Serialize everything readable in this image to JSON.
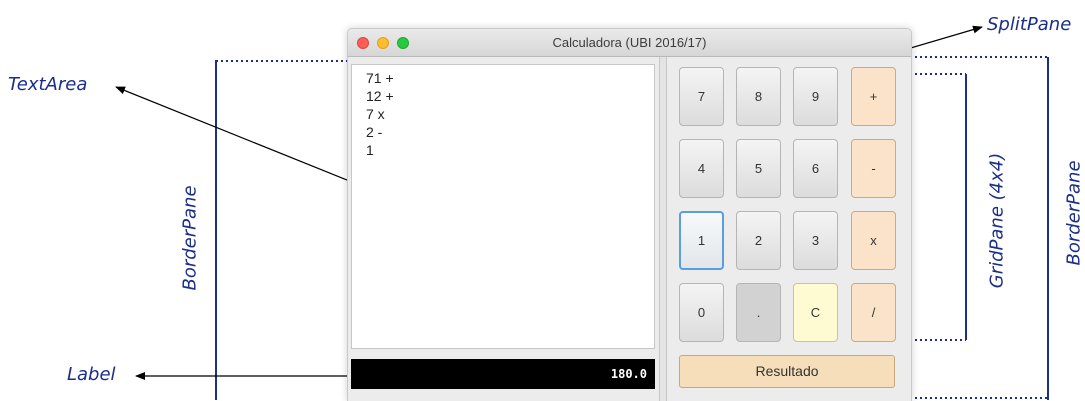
{
  "window": {
    "title": "Calculadora  (UBI 2016/17)"
  },
  "text_area": {
    "lines": [
      "71 +",
      "12 +",
      "7 x",
      "2 -",
      "1"
    ]
  },
  "label": {
    "value": "180.0"
  },
  "keypad": {
    "rows": [
      [
        "7",
        "8",
        "9",
        "+"
      ],
      [
        "4",
        "5",
        "6",
        "-"
      ],
      [
        "1",
        "2",
        "3",
        "x"
      ],
      [
        "0",
        ".",
        "C",
        "/"
      ]
    ]
  },
  "result_button": {
    "label": "Resultado"
  },
  "annotations": {
    "split_pane": "SplitPane",
    "text_area": "TextArea",
    "label": "Label",
    "border_pane_left": "BorderPane",
    "grid_pane": "GridPane (4x4)",
    "border_pane_right": "BorderPane"
  },
  "colors": {
    "annotation": "#1a2e8a",
    "operator_button": "#fbe3c9",
    "clear_button": "#fefad2",
    "result_button": "#f6deba",
    "label_background": "#000000"
  }
}
